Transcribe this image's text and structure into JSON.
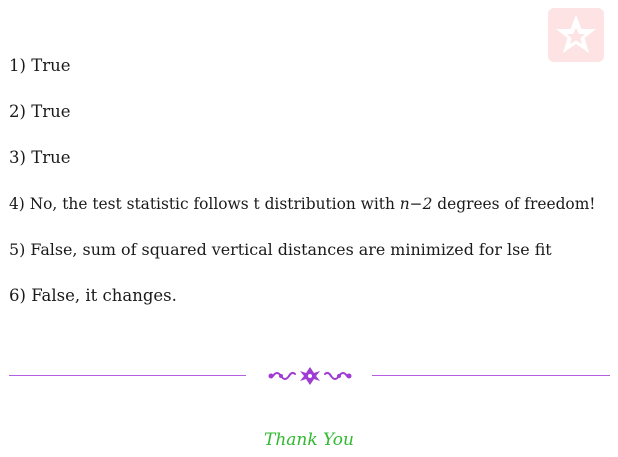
{
  "icons": {
    "logo": "star-badge-icon",
    "ornament": "floral-ornament-icon"
  },
  "colors": {
    "logo_background": "#fde3e3",
    "logo_star": "#ffffff",
    "divider": "#b45fe0",
    "ornament": "#a13bd6",
    "thanks": "#2fba2f"
  },
  "answers": [
    {
      "number": "1)",
      "text": "True"
    },
    {
      "number": "2)",
      "text": "True"
    },
    {
      "number": "3)",
      "text": "True"
    },
    {
      "number": "4)",
      "text_before": "No, the test statistic follows t distribution with",
      "math": "n−2",
      "text_after": "degrees of freedom!"
    },
    {
      "number": "5)",
      "text": "False, sum of squared vertical distances are minimized for lse fit"
    },
    {
      "number": "6)",
      "text": "False, it changes."
    }
  ],
  "closing": "Thank You"
}
